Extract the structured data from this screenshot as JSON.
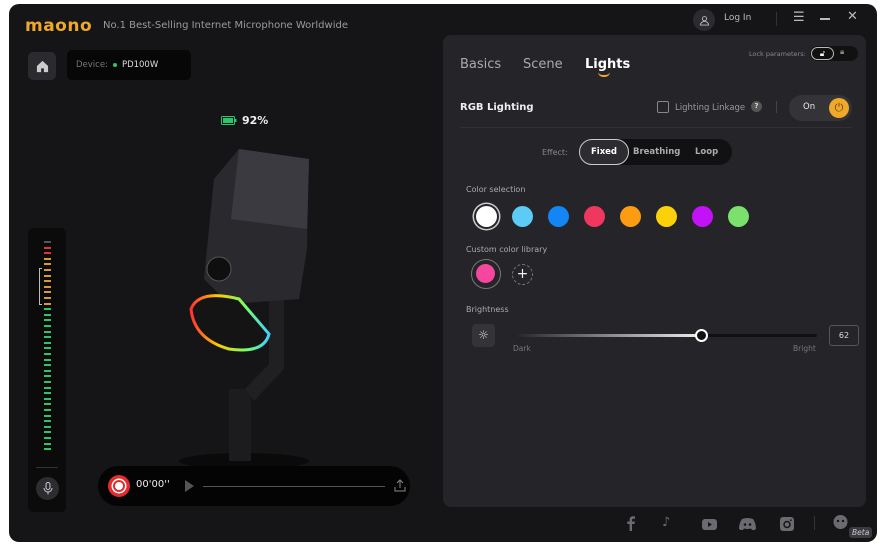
{
  "header": {
    "logo": "maono",
    "slogan": "No.1 Best-Selling Internet Microphone Worldwide",
    "login": "Log In"
  },
  "device": {
    "label": "Device:",
    "name": "PD100W",
    "status_color": "#2ec46b"
  },
  "battery": {
    "percent": "92%"
  },
  "recorder": {
    "time": "00'00''"
  },
  "panel": {
    "tabs": [
      {
        "label": "Basics"
      },
      {
        "label": "Scene"
      },
      {
        "label": "Lights",
        "active": true
      }
    ],
    "lock_label": "Lock parameters:",
    "section_title": "RGB Lighting",
    "linkage_label": "Lighting Linkage",
    "linkage_checked": false,
    "power_label": "On",
    "effect_label": "Effect:",
    "effects": [
      "Fixed",
      "Breathing",
      "Loop"
    ],
    "effect_selected": "Fixed",
    "color_selection_label": "Color selection",
    "colors": [
      "#ffffff",
      "#5ccbf5",
      "#1485f5",
      "#ef3760",
      "#fb9c12",
      "#fdd10a",
      "#c312f5",
      "#7ae16c"
    ],
    "selected_color": "#ffffff",
    "custom_label": "Custom color library",
    "custom_colors": [
      "#f5479e"
    ],
    "brightness_label": "Brightness",
    "brightness_min_label": "Dark",
    "brightness_max_label": "Bright",
    "brightness_value": "62"
  },
  "footer": {
    "beta": "Beta",
    "icons": [
      "facebook-icon",
      "tiktok-icon",
      "youtube-icon",
      "discord-icon",
      "instagram-icon",
      "chat-bot-icon"
    ]
  },
  "accent": "#f0a82a"
}
